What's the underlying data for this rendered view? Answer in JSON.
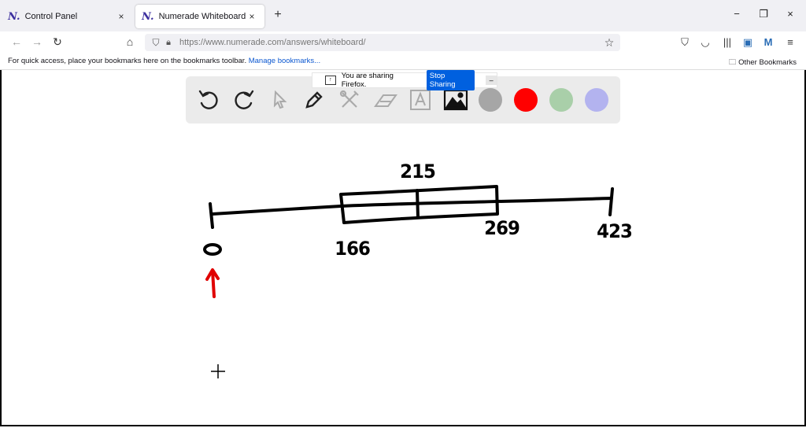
{
  "tabs": [
    {
      "favicon": "N.",
      "title": "Control Panel",
      "close": "×"
    },
    {
      "favicon": "N.",
      "title": "Numerade Whiteboard",
      "close": "×"
    }
  ],
  "new_tab": "+",
  "window": {
    "minimize": "−",
    "restore": "❐",
    "close": "×"
  },
  "address_bar": {
    "url": "https://www.numerade.com/answers/whiteboard/"
  },
  "bookmarks_bar": {
    "message": "For quick access, place your bookmarks here on the bookmarks toolbar.",
    "link": "Manage bookmarks...",
    "other": "Other Bookmarks"
  },
  "sharing": {
    "text": "You are sharing Firefox.",
    "stop_label": "Stop Sharing",
    "minimize": "–"
  },
  "toolbar": {
    "tools": [
      "undo-icon",
      "redo-icon",
      "pointer-icon",
      "pen-icon",
      "tools-icon",
      "eraser-icon",
      "text-icon",
      "image-icon"
    ],
    "colors": {
      "gray": "#a6a6a6",
      "red": "#ff0000",
      "green": "#a9cfa9",
      "purple": "#b3b3ef"
    }
  },
  "board": {
    "labels": {
      "min": "0",
      "q1": "166",
      "median": "215",
      "q3": "269",
      "max": "423"
    },
    "ink_color": "#000000",
    "arrow_color": "#e00000"
  }
}
